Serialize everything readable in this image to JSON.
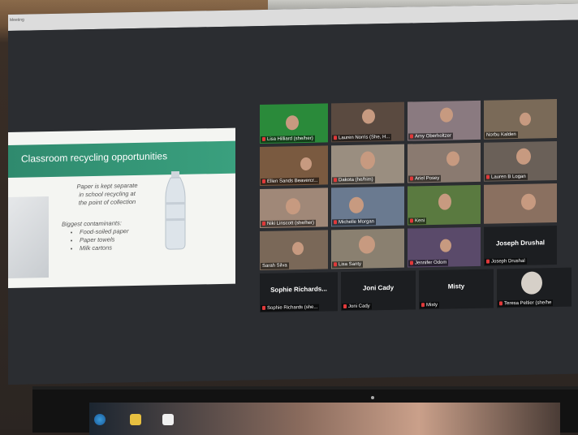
{
  "window": {
    "title": "Meeting"
  },
  "slide": {
    "title": "Classroom recycling opportunities",
    "line1": "Paper is kept separate",
    "line2": "in school recycling at",
    "line3": "the point of collection",
    "contaminants_heading": "Biggest contaminants:",
    "contaminants": [
      "Food-soiled paper",
      "Paper towels",
      "Milk cartons"
    ]
  },
  "participants": [
    {
      "name": "Lisa Hilliard (she/her)"
    },
    {
      "name": "Lauren Norris (She, H..."
    },
    {
      "name": "Amy Oberholtzer"
    },
    {
      "name": "Norbu Kalden"
    },
    {
      "name": "Ellen Sands Beavercr..."
    },
    {
      "name": "Dakota (he/him)"
    },
    {
      "name": "Ariel Posey"
    },
    {
      "name": "Lauren B Logan"
    },
    {
      "name": "Niki Linscott (she/her)"
    },
    {
      "name": "Michelle Morgan"
    },
    {
      "name": "Keni"
    },
    {
      "name": "Sarah Silva"
    },
    {
      "name": "Lisa Santy"
    },
    {
      "name": "Jennifer Odom"
    },
    {
      "name": "Joseph Drushal",
      "center": "Joseph Drushal"
    },
    {
      "name": "Sophie Richards (she...",
      "center": "Sophie Richards..."
    },
    {
      "name": "Joni Cady",
      "center": "Joni Cady"
    },
    {
      "name": "Misty",
      "center": "Misty"
    },
    {
      "name": "Teresa Peltier (she/he"
    }
  ],
  "colors": {
    "slide_header": "#2f8a6e",
    "mic_muted": "#e0393a",
    "screen_bg": "#2b2d31"
  }
}
